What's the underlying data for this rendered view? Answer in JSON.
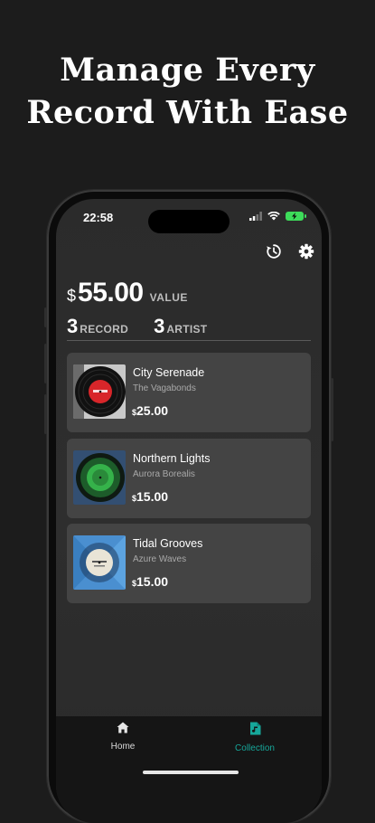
{
  "headline": {
    "line1": "Manage Every",
    "line2": "Record With Ease"
  },
  "status_bar": {
    "time": "22:58"
  },
  "toolbar": {
    "history_icon": "history-icon",
    "settings_icon": "gear-icon"
  },
  "summary": {
    "currency_symbol": "$",
    "total_value": "55.00",
    "value_label": "VALUE",
    "record_count": "3",
    "record_label": "RECORD",
    "artist_count": "3",
    "artist_label": "ARTIST"
  },
  "records": [
    {
      "title": "City Serenade",
      "artist": "The Vagabonds",
      "currency": "$",
      "price": "25.00",
      "cover_color": "#d8262a"
    },
    {
      "title": "Northern Lights",
      "artist": "Aurora Borealis",
      "currency": "$",
      "price": "15.00",
      "cover_color": "#35b24a"
    },
    {
      "title": "Tidal Grooves",
      "artist": "Azure Waves",
      "currency": "$",
      "price": "15.00",
      "cover_color": "#4a8fd0"
    }
  ],
  "tabs": [
    {
      "label": "Home",
      "icon": "home-icon",
      "active": false
    },
    {
      "label": "Collection",
      "icon": "music-file-icon",
      "active": true
    }
  ],
  "colors": {
    "accent": "#16a79a",
    "background": "#1c1c1c",
    "card": "#444444"
  }
}
